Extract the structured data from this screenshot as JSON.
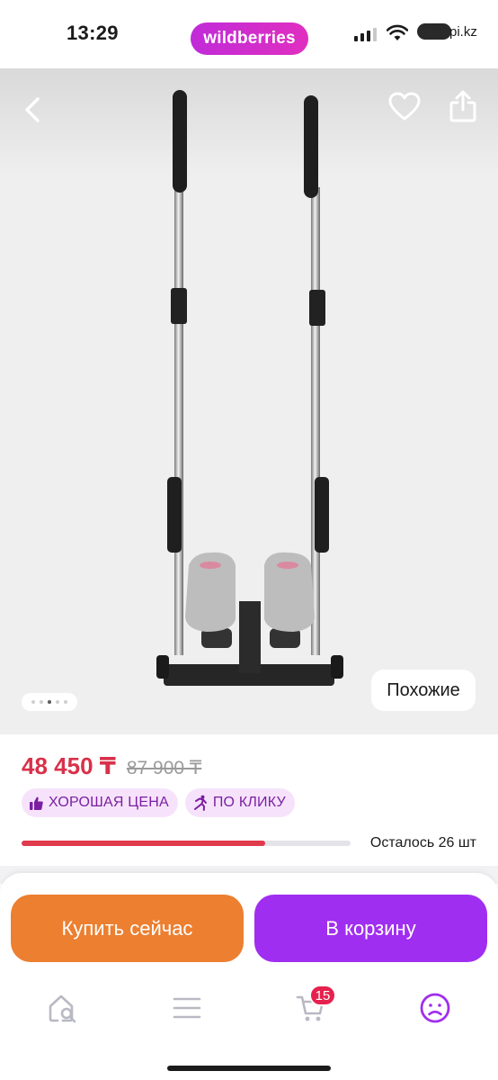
{
  "status_bar": {
    "time": "13:29",
    "brand": "wildberries",
    "carrier": "pi.kz"
  },
  "gallery": {
    "icons": [
      "back-icon",
      "heart-icon",
      "share-icon"
    ],
    "image_subject": "stepper-exercise-machine",
    "slide_count": 5,
    "active_slide": 3,
    "similar_label": "Похожие"
  },
  "product": {
    "price": "48 450 ₸",
    "old_price": "87 900 ₸",
    "badges": [
      {
        "icon": "thumbs-up-icon",
        "label": "ХОРОШАЯ ЦЕНА"
      },
      {
        "icon": "running-person-icon",
        "label": "ПО КЛИКУ"
      }
    ],
    "stock_fraction": 0.74,
    "stock_text": "Осталось 26 шт"
  },
  "actions": {
    "buy_now_label": "Купить сейчас",
    "add_to_cart_label": "В корзину"
  },
  "tabbar": {
    "items": [
      "home-search-icon",
      "menu-icon",
      "cart-icon",
      "profile-icon"
    ],
    "cart_count": "15",
    "active": "profile-icon"
  },
  "colors": {
    "brand": "#cb2bd0",
    "price": "#d8314a",
    "buy_button": "#ec7f30",
    "cart_button": "#a02ef0",
    "badge_bg": "#f6e3fb",
    "badge_text": "#7b1fa2",
    "stock_fill": "#e03a4d"
  }
}
